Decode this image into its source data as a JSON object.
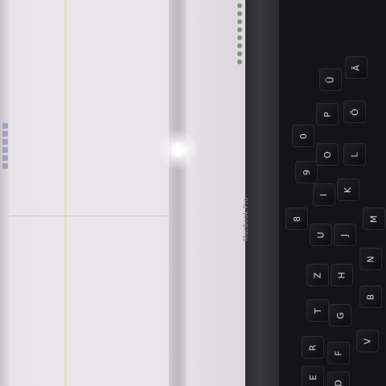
{
  "device": {
    "brand_label": "MacBook Pro"
  },
  "keyboard": {
    "keys": [
      "8",
      "9",
      "0",
      "P",
      "Ü",
      "L",
      "Ö",
      "Ä",
      "K",
      "J",
      "M",
      "N",
      "U",
      "I",
      "O",
      "H",
      "Z",
      "T",
      "G",
      "B",
      "V",
      "F",
      "R",
      "E",
      "D"
    ]
  },
  "screen": {
    "content": "blurred source code editor, unreadable"
  }
}
